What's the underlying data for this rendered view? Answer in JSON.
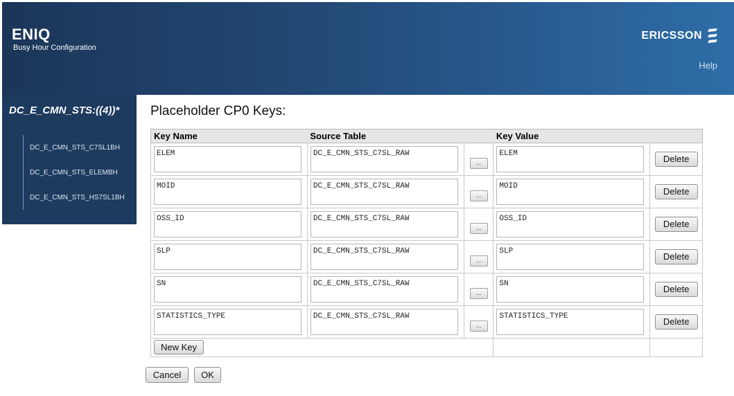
{
  "header": {
    "app_name": "ENIQ",
    "app_subtitle": "Busy Hour Configuration",
    "brand": "ERICSSON",
    "brand_icon": "ericsson-logo-icon",
    "help_label": "Help"
  },
  "sidebar": {
    "title": "DC_E_CMN_STS:((4))*",
    "items": [
      {
        "label": "DC_E_CMN_STS_C7SL1BH"
      },
      {
        "label": "DC_E_CMN_STS_ELEMBH"
      },
      {
        "label": "DC_E_CMN_STS_HS7SL1BH"
      }
    ]
  },
  "section_title": "Placeholder CP0 Keys:",
  "table": {
    "columns": [
      "Key Name",
      "Source Table",
      "Key Value"
    ],
    "rows": [
      {
        "key_name": "ELEM",
        "source_table": "DC_E_CMN_STS_C7SL_RAW",
        "key_value": "ELEM"
      },
      {
        "key_name": "MOID",
        "source_table": "DC_E_CMN_STS_C7SL_RAW",
        "key_value": "MOID"
      },
      {
        "key_name": "OSS_ID",
        "source_table": "DC_E_CMN_STS_C7SL_RAW",
        "key_value": "OSS_ID"
      },
      {
        "key_name": "SLP",
        "source_table": "DC_E_CMN_STS_C7SL_RAW",
        "key_value": "SLP"
      },
      {
        "key_name": "SN",
        "source_table": "DC_E_CMN_STS_C7SL_RAW",
        "key_value": "SN"
      },
      {
        "key_name": "STATISTICS_TYPE",
        "source_table": "DC_E_CMN_STS_C7SL_RAW",
        "key_value": "STATISTICS_TYPE"
      }
    ],
    "browse_label": "...",
    "delete_label": "Delete",
    "new_key_label": "New Key"
  },
  "footer": {
    "cancel_label": "Cancel",
    "ok_label": "OK"
  },
  "colors": {
    "header_start": "#1b3558",
    "header_end": "#2e6da8",
    "sidebar_bg": "#1d3a5f"
  }
}
